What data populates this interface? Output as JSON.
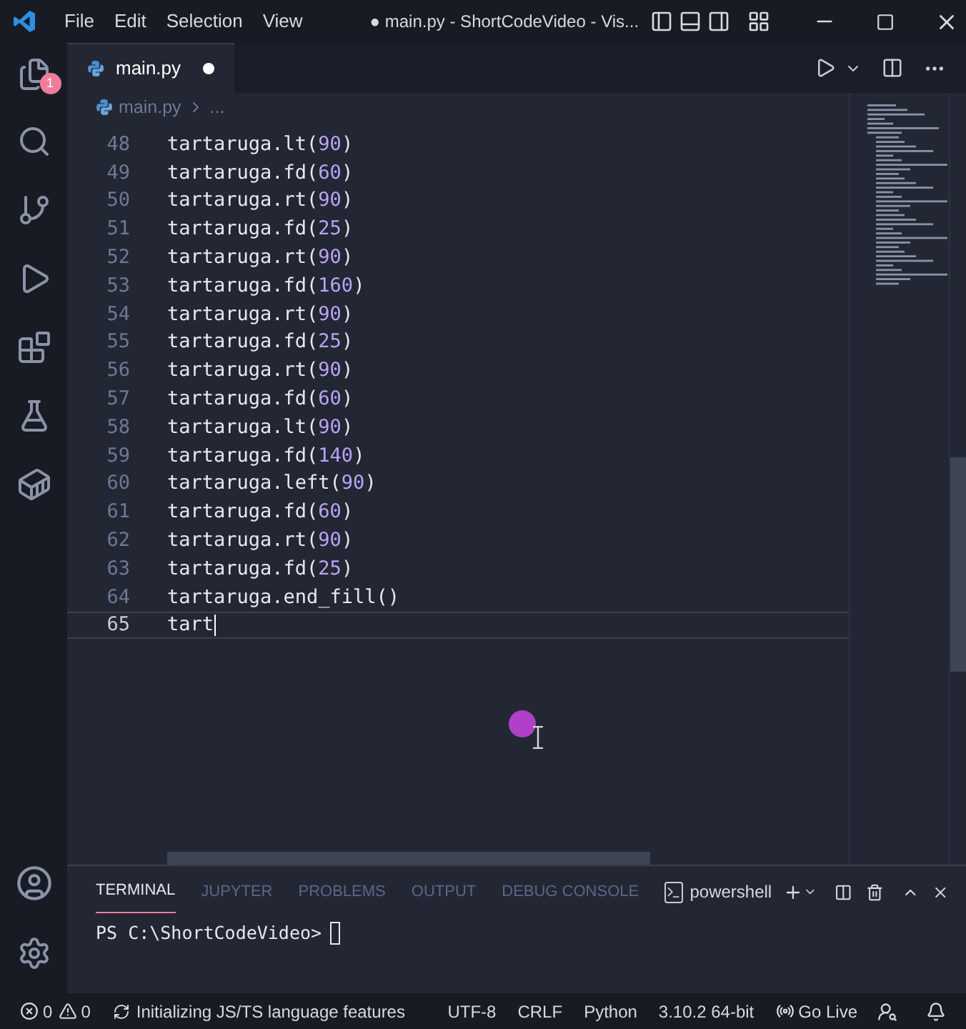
{
  "title_bar": {
    "menu": [
      "File",
      "Edit",
      "Selection",
      "View"
    ],
    "title": "● main.py - ShortCodeVideo - Vis..."
  },
  "activity_bar": {
    "explorer_badge": "1"
  },
  "editor_tabs": [
    {
      "label": "main.py",
      "selected": true,
      "modified": true
    }
  ],
  "breadcrumb": {
    "file": "main.py",
    "more": "..."
  },
  "code_lines": [
    {
      "number": "48",
      "tokens": [
        {
          "kind": "plain",
          "text": "tartaruga.lt("
        },
        {
          "kind": "number",
          "text": "90"
        },
        {
          "kind": "plain",
          "text": ")"
        }
      ]
    },
    {
      "number": "49",
      "tokens": [
        {
          "kind": "plain",
          "text": "tartaruga.fd("
        },
        {
          "kind": "number",
          "text": "60"
        },
        {
          "kind": "plain",
          "text": ")"
        }
      ]
    },
    {
      "number": "50",
      "tokens": [
        {
          "kind": "plain",
          "text": "tartaruga.rt("
        },
        {
          "kind": "number",
          "text": "90"
        },
        {
          "kind": "plain",
          "text": ")"
        }
      ]
    },
    {
      "number": "51",
      "tokens": [
        {
          "kind": "plain",
          "text": "tartaruga.fd("
        },
        {
          "kind": "number",
          "text": "25"
        },
        {
          "kind": "plain",
          "text": ")"
        }
      ]
    },
    {
      "number": "52",
      "tokens": [
        {
          "kind": "plain",
          "text": "tartaruga.rt("
        },
        {
          "kind": "number",
          "text": "90"
        },
        {
          "kind": "plain",
          "text": ")"
        }
      ]
    },
    {
      "number": "53",
      "tokens": [
        {
          "kind": "plain",
          "text": "tartaruga.fd("
        },
        {
          "kind": "number",
          "text": "160"
        },
        {
          "kind": "plain",
          "text": ")"
        }
      ]
    },
    {
      "number": "54",
      "tokens": [
        {
          "kind": "plain",
          "text": "tartaruga.rt("
        },
        {
          "kind": "number",
          "text": "90"
        },
        {
          "kind": "plain",
          "text": ")"
        }
      ]
    },
    {
      "number": "55",
      "tokens": [
        {
          "kind": "plain",
          "text": "tartaruga.fd("
        },
        {
          "kind": "number",
          "text": "25"
        },
        {
          "kind": "plain",
          "text": ")"
        }
      ]
    },
    {
      "number": "56",
      "tokens": [
        {
          "kind": "plain",
          "text": "tartaruga.rt("
        },
        {
          "kind": "number",
          "text": "90"
        },
        {
          "kind": "plain",
          "text": ")"
        }
      ]
    },
    {
      "number": "57",
      "tokens": [
        {
          "kind": "plain",
          "text": "tartaruga.fd("
        },
        {
          "kind": "number",
          "text": "60"
        },
        {
          "kind": "plain",
          "text": ")"
        }
      ]
    },
    {
      "number": "58",
      "tokens": [
        {
          "kind": "plain",
          "text": "tartaruga.lt("
        },
        {
          "kind": "number",
          "text": "90"
        },
        {
          "kind": "plain",
          "text": ")"
        }
      ]
    },
    {
      "number": "59",
      "tokens": [
        {
          "kind": "plain",
          "text": "tartaruga.fd("
        },
        {
          "kind": "number",
          "text": "140"
        },
        {
          "kind": "plain",
          "text": ")"
        }
      ]
    },
    {
      "number": "60",
      "tokens": [
        {
          "kind": "plain",
          "text": "tartaruga.left("
        },
        {
          "kind": "number",
          "text": "90"
        },
        {
          "kind": "plain",
          "text": ")"
        }
      ]
    },
    {
      "number": "61",
      "tokens": [
        {
          "kind": "plain",
          "text": "tartaruga.fd("
        },
        {
          "kind": "number",
          "text": "60"
        },
        {
          "kind": "plain",
          "text": ")"
        }
      ]
    },
    {
      "number": "62",
      "tokens": [
        {
          "kind": "plain",
          "text": "tartaruga.rt("
        },
        {
          "kind": "number",
          "text": "90"
        },
        {
          "kind": "plain",
          "text": ")"
        }
      ]
    },
    {
      "number": "63",
      "tokens": [
        {
          "kind": "plain",
          "text": "tartaruga.fd("
        },
        {
          "kind": "number",
          "text": "25"
        },
        {
          "kind": "plain",
          "text": ")"
        }
      ]
    },
    {
      "number": "64",
      "tokens": [
        {
          "kind": "plain",
          "text": "tartaruga.end_fill()"
        }
      ]
    },
    {
      "number": "65",
      "current": true,
      "tokens": [
        {
          "kind": "plain",
          "text": "tart"
        }
      ]
    }
  ],
  "panel": {
    "tabs": [
      {
        "label": "TERMINAL",
        "selected": true
      },
      {
        "label": "JUPYTER",
        "selected": false
      },
      {
        "label": "PROBLEMS",
        "selected": false
      },
      {
        "label": "OUTPUT",
        "selected": false
      },
      {
        "label": "DEBUG CONSOLE",
        "selected": false
      }
    ],
    "shell": "powershell",
    "prompt": "PS C:\\ShortCodeVideo>"
  },
  "status_bar": {
    "errors": "0",
    "warnings": "0",
    "task": "Initializing JS/TS language features",
    "encoding": "UTF-8",
    "eol": "CRLF",
    "language": "Python",
    "interpreter": "3.10.2 64-bit",
    "live": "Go Live"
  }
}
